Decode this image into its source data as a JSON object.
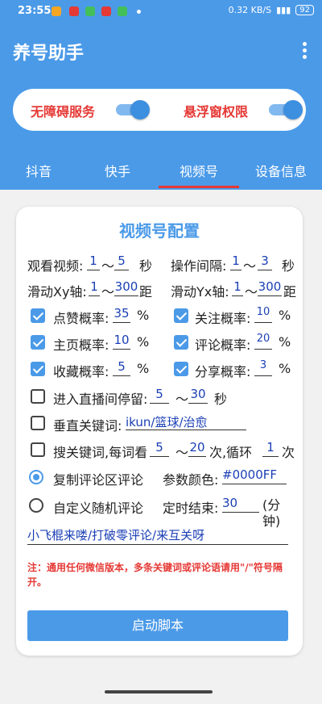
{
  "status": {
    "time": "23:55",
    "speed": "0.32 KB/S",
    "battery": "92"
  },
  "app": {
    "title": "养号助手"
  },
  "permissions": {
    "accessibility_label": "无障碍服务",
    "overlay_label": "悬浮窗权限"
  },
  "tabs": [
    {
      "label": "抖音"
    },
    {
      "label": "快手"
    },
    {
      "label": "视频号"
    },
    {
      "label": "设备信息"
    }
  ],
  "config": {
    "title": "视频号配置",
    "watch_label": "观看视频:",
    "watch_min": "1",
    "watch_max": "5",
    "sec_unit": "秒",
    "interval_label": "操作间隔:",
    "interval_min": "1",
    "interval_max": "3",
    "interval_unit": "秒",
    "xy_label": "滑动Xy轴:",
    "xy_min": "1",
    "xy_max": "300",
    "dist_unit": "距",
    "yx_label": "滑动Yx轴:",
    "yx_min": "1",
    "yx_max": "300",
    "dist_unit2": "距",
    "tilde": "～",
    "like_label": "点赞概率:",
    "like_val": "35",
    "follow_label": "关注概率:",
    "follow_val": "10",
    "home_label": "主页概率:",
    "home_val": "10",
    "comment_label": "评论概率:",
    "comment_val": "20",
    "fav_label": "收藏概率:",
    "fav_val": "5",
    "share_label": "分享概率:",
    "share_val": "3",
    "percent": "%",
    "live_label": "进入直播间停留:",
    "live_min": "5",
    "live_max": "30",
    "live_unit": "秒",
    "kw_label": "垂直关键词:",
    "kw_val": "ikun/篮球/治愈",
    "search_label": "搜关键词,每词看",
    "search_min": "5",
    "search_max": "20",
    "search_mid": "次,循环",
    "search_loop": "1",
    "search_unit": "次",
    "copy_label": "复制评论区评论",
    "color_label": "参数颜色:",
    "color_val": "#0000FF",
    "custom_label": "自定义随机评论",
    "timer_label": "定时结束:",
    "timer_val": "30",
    "timer_unit": "(分钟)",
    "comments_val": "小飞棍来喽/打破零评论/来互关呀",
    "note": "注：通用任何微信版本，多条关键词或评论语请用\"/\"符号隔开。",
    "start_label": "启动脚本"
  }
}
